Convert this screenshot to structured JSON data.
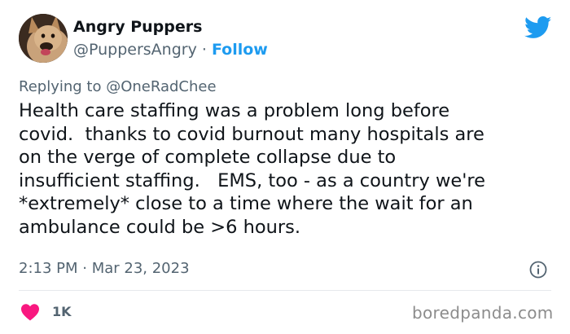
{
  "author": {
    "display_name": "Angry Puppers",
    "handle": "@PuppersAngry",
    "separator": " · ",
    "follow_label": "Follow"
  },
  "reply": {
    "prefix": "Replying to ",
    "handle": "@OneRadChee"
  },
  "tweet": {
    "text": "Health care staffing was a problem long before\ncovid.  thanks to covid burnout many hospitals are\non the verge of complete collapse due to\ninsufficient staffing.   EMS, too - as a country we're\n*extremely* close to a time where the wait for an\nambulance could be >6 hours.",
    "timestamp": "2:13 PM · Mar 23, 2023"
  },
  "engagement": {
    "like_count": "1K"
  },
  "watermark": "boredpanda.com",
  "icons": {
    "brand": "twitter-bird-icon",
    "info": "info-icon",
    "like": "heart-icon"
  },
  "colors": {
    "text_primary": "#0f1419",
    "text_secondary": "#536471",
    "accent_blue": "#1d9bf0",
    "like_pink": "#f91880",
    "divider": "#e6e9ec",
    "watermark": "#8c8c8c"
  }
}
